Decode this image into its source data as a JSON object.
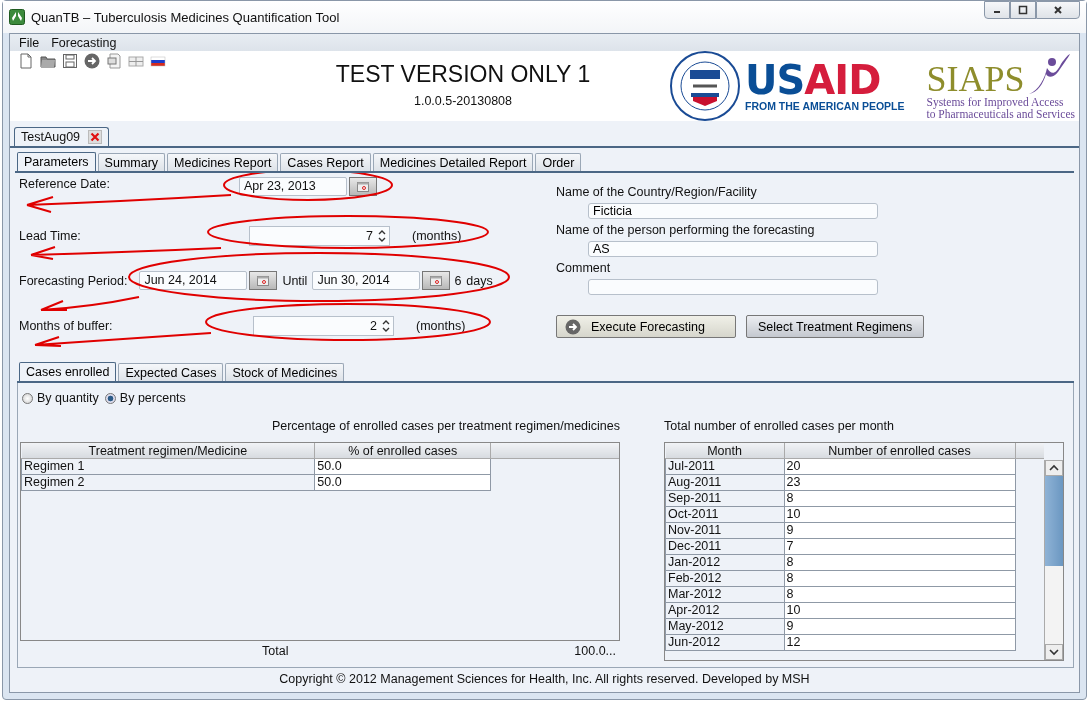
{
  "window": {
    "title": "QuanTB – Tuberculosis Medicines Quantification Tool"
  },
  "menu": [
    "File",
    "Forecasting"
  ],
  "header": {
    "title": "TEST VERSION ONLY 1",
    "version": "1.0.0.5-20130808",
    "usaid": {
      "wordmark_1": "US",
      "wordmark_2": "AID",
      "tagline": "FROM THE AMERICAN PEOPLE"
    },
    "siaps": {
      "wordmark": "SIAPS",
      "tagline_1": "Systems for Improved Access",
      "tagline_2": "to Pharmaceuticals and Services"
    }
  },
  "document_tabs": [
    {
      "label": "TestAug09",
      "selected": true
    }
  ],
  "tabs": [
    {
      "label": "Parameters",
      "selected": true
    },
    {
      "label": "Summary",
      "selected": false
    },
    {
      "label": "Medicines Report",
      "selected": false
    },
    {
      "label": "Cases Report",
      "selected": false
    },
    {
      "label": "Medicines Detailed Report",
      "selected": false
    },
    {
      "label": "Order",
      "selected": false
    }
  ],
  "parameters": {
    "reference_date": {
      "label": "Reference Date:",
      "value": "Apr 23, 2013"
    },
    "lead_time": {
      "label": "Lead Time:",
      "value": "7",
      "unit": "(months)"
    },
    "forecasting_period": {
      "label": "Forecasting Period:",
      "start": "Jun 24, 2014",
      "until": "Until",
      "end": "Jun 30, 2014",
      "days": "6",
      "days_unit": "days"
    },
    "buffer": {
      "label": "Months of buffer:",
      "value": "2",
      "unit": "(months)"
    }
  },
  "details": [
    {
      "label": "Name of the Country/Region/Facility",
      "value": "Ficticia"
    },
    {
      "label": "Name of the person performing the forecasting",
      "value": "AS"
    },
    {
      "label": "Comment"
    }
  ],
  "buttons": [
    {
      "label": "Execute Forecasting",
      "kind": "icon"
    },
    {
      "label": "Select Treatment Regimens",
      "kind": "plain"
    }
  ],
  "sub_tabs": [
    {
      "label": "Cases enrolled",
      "selected": true
    },
    {
      "label": "Expected Cases",
      "selected": false
    },
    {
      "label": "Stock of Medicines",
      "selected": false
    }
  ],
  "mode": [
    {
      "label": "By quantity",
      "selected": false
    },
    {
      "label": "By percents",
      "selected": true
    }
  ],
  "regimen_table": {
    "caption": "Percentage of enrolled cases per treatment regimen/medicines",
    "columns": [
      "Treatment regimen/Medicine",
      "% of enrolled cases"
    ],
    "rows": [
      [
        "Regimen 1",
        "50.0"
      ],
      [
        "Regimen 2",
        "50.0"
      ]
    ],
    "total_label": "Total",
    "total_value": "100.0..."
  },
  "monthly_table": {
    "caption": "Total number of enrolled cases per month",
    "columns": [
      "Month",
      "Number of enrolled cases"
    ],
    "rows": [
      [
        "Jul-2011",
        "20"
      ],
      [
        "Aug-2011",
        "23"
      ],
      [
        "Sep-2011",
        "8"
      ],
      [
        "Oct-2011",
        "10"
      ],
      [
        "Nov-2011",
        "9"
      ],
      [
        "Dec-2011",
        "7"
      ],
      [
        "Jan-2012",
        "8"
      ],
      [
        "Feb-2012",
        "8"
      ],
      [
        "Mar-2012",
        "8"
      ],
      [
        "Apr-2012",
        "10"
      ],
      [
        "May-2012",
        "9"
      ],
      [
        "Jun-2012",
        "12"
      ]
    ]
  },
  "footer": "Copyright © 2012 Management Sciences for Health, Inc. All rights reserved. Developed by MSH"
}
